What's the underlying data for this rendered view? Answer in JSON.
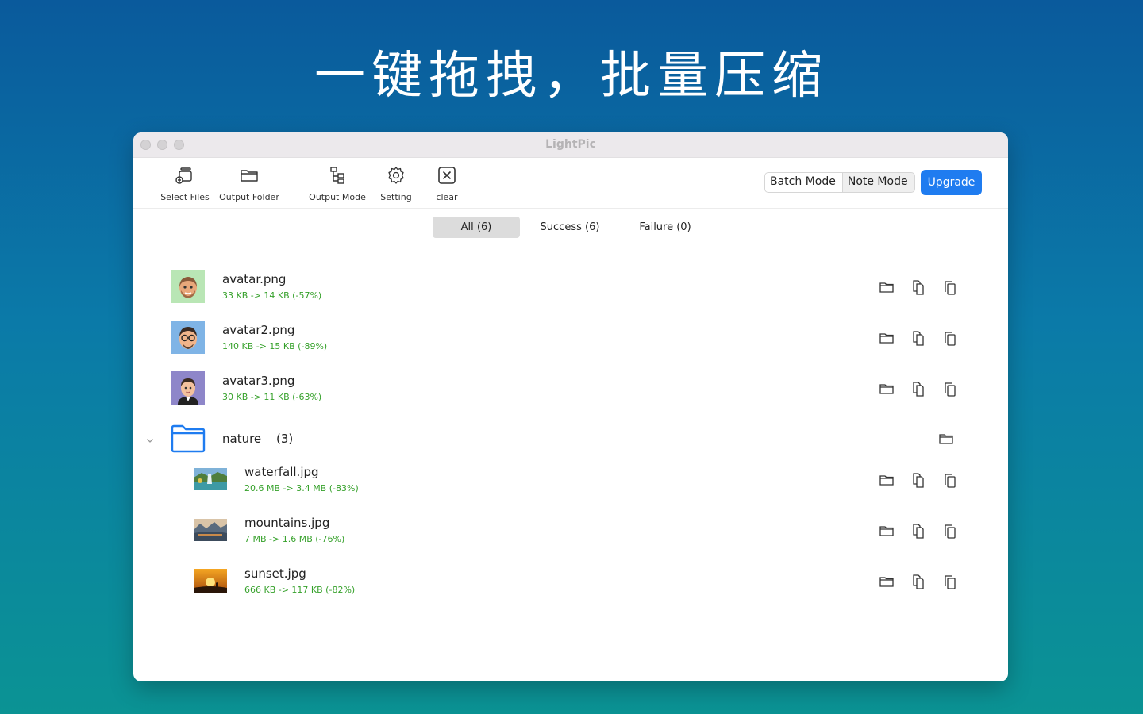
{
  "headline": "一键拖拽，批量压缩",
  "window": {
    "title": "LightPic"
  },
  "toolbar": {
    "select_files": "Select Files",
    "output_folder": "Output Folder",
    "output_mode": "Output Mode",
    "setting": "Setting",
    "clear": "clear",
    "batch_mode": "Batch Mode",
    "note_mode": "Note Mode",
    "upgrade": "Upgrade"
  },
  "filters": {
    "all": "All (6)",
    "success": "Success (6)",
    "failure": "Failure (0)"
  },
  "files": [
    {
      "name": "avatar.png",
      "size": "33 KB -> 14 KB (-57%)"
    },
    {
      "name": "avatar2.png",
      "size": "140 KB -> 15 KB (-89%)"
    },
    {
      "name": "avatar3.png",
      "size": "30 KB -> 11 KB (-63%)"
    }
  ],
  "folder": {
    "name": "nature",
    "count": "(3)",
    "files": [
      {
        "name": "waterfall.jpg",
        "size": "20.6 MB -> 3.4 MB (-83%)"
      },
      {
        "name": "mountains.jpg",
        "size": "7 MB -> 1.6 MB (-76%)"
      },
      {
        "name": "sunset.jpg",
        "size": "666 KB -> 117 KB (-82%)"
      }
    ]
  },
  "colors": {
    "accent": "#1f7cf0",
    "success_text": "#36a12b",
    "folder_icon": "#1f7cf0"
  },
  "icons": [
    "add-files-icon",
    "folder-icon",
    "output-mode-icon",
    "gear-icon",
    "close-box-icon",
    "reveal-folder-icon",
    "copy-icon",
    "duplicate-icon",
    "chevron-down-icon"
  ]
}
